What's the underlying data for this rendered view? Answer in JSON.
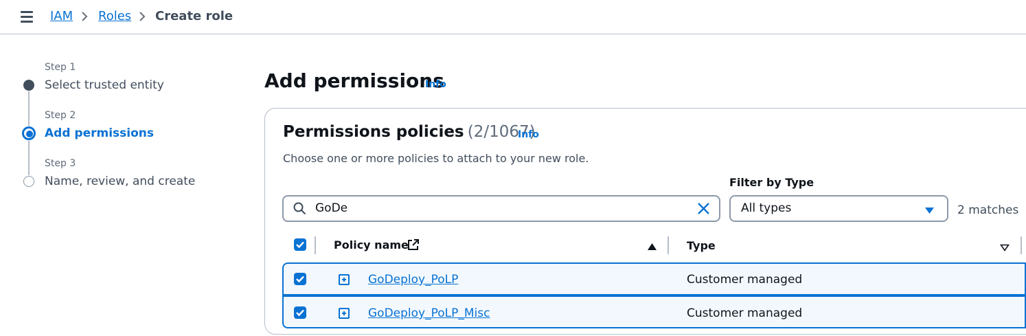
{
  "breadcrumb": {
    "items": [
      "IAM",
      "Roles",
      "Create role"
    ]
  },
  "steps": [
    {
      "step": "Step 1",
      "label": "Select trusted entity",
      "state": "completed"
    },
    {
      "step": "Step 2",
      "label": "Add permissions",
      "state": "active"
    },
    {
      "step": "Step 3",
      "label": "Name, review, and create",
      "state": "pending"
    }
  ],
  "page": {
    "title": "Add permissions",
    "info": "Info"
  },
  "policies": {
    "title": "Permissions policies",
    "count": "(2/1067)",
    "info": "Info",
    "description": "Choose one or more policies to attach to your new role.",
    "search_value": "GoDe",
    "filter_label": "Filter by Type",
    "filter_value": "All types",
    "matches": "2 matches",
    "columns": {
      "name": "Policy name",
      "type": "Type"
    },
    "rows": [
      {
        "name": "GoDeploy_PoLP",
        "type": "Customer managed",
        "checked": true
      },
      {
        "name": "GoDeploy_PoLP_Misc",
        "type": "Customer managed",
        "checked": true
      }
    ]
  },
  "colors": {
    "accent": "#0972d3",
    "row_selected_bg": "#f2f8fd"
  },
  "icons": [
    "menu-icon",
    "chevron-right-icon",
    "search-icon",
    "clear-icon",
    "caret-down-icon",
    "external-link-icon",
    "sort-ascending-icon",
    "sort-descending-icon",
    "expand-icon",
    "checkbox-checked-icon"
  ]
}
